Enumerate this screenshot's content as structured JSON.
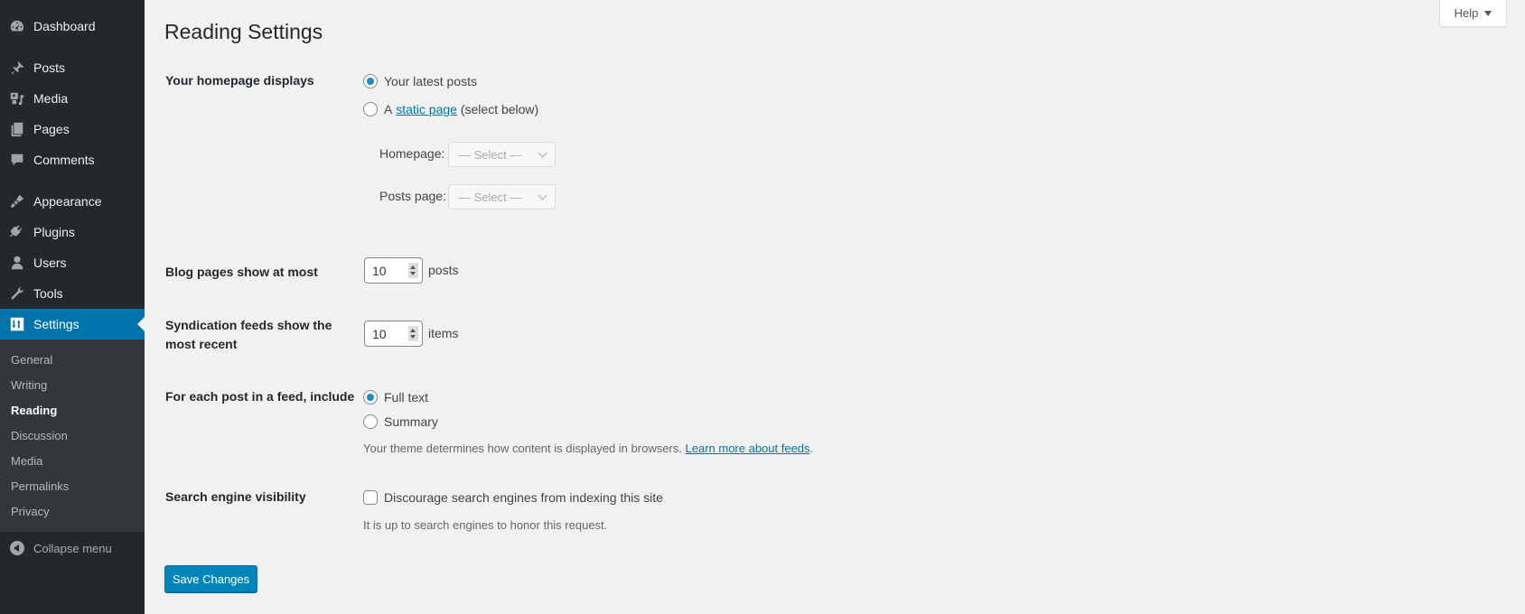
{
  "sidebar": {
    "items": [
      {
        "label": "Dashboard",
        "icon": "dashboard-icon"
      },
      {
        "label": "Posts",
        "icon": "pin-icon"
      },
      {
        "label": "Media",
        "icon": "media-icon"
      },
      {
        "label": "Pages",
        "icon": "pages-icon"
      },
      {
        "label": "Comments",
        "icon": "comment-icon"
      },
      {
        "label": "Appearance",
        "icon": "paintbrush-icon"
      },
      {
        "label": "Plugins",
        "icon": "plugin-icon"
      },
      {
        "label": "Users",
        "icon": "user-icon"
      },
      {
        "label": "Tools",
        "icon": "wrench-icon"
      },
      {
        "label": "Settings",
        "icon": "settings-icon",
        "current": true
      }
    ],
    "submenu": [
      {
        "label": "General"
      },
      {
        "label": "Writing"
      },
      {
        "label": "Reading",
        "current": true
      },
      {
        "label": "Discussion"
      },
      {
        "label": "Media"
      },
      {
        "label": "Permalinks"
      },
      {
        "label": "Privacy"
      }
    ],
    "collapse_label": "Collapse menu"
  },
  "header": {
    "help_label": "Help"
  },
  "page": {
    "title": "Reading Settings",
    "homepage": {
      "label": "Your homepage displays",
      "option_latest": "Your latest posts",
      "option_static_prefix": "A",
      "option_static_link": "static page",
      "option_static_suffix": "(select below)",
      "selected": "latest",
      "homepage_select_label": "Homepage:",
      "homepage_select_value": "— Select —",
      "posts_select_label": "Posts page:",
      "posts_select_value": "— Select —"
    },
    "blog_pages": {
      "label": "Blog pages show at most",
      "value": "10",
      "unit": "posts"
    },
    "syndication": {
      "label_line1": "Syndication feeds show the",
      "label_line2": "most recent",
      "value": "10",
      "unit": "items"
    },
    "feed_content": {
      "label": "For each post in a feed, include",
      "option_full": "Full text",
      "option_summary": "Summary",
      "selected": "full",
      "description": "Your theme determines how content is displayed in browsers.",
      "learn_more_link": "Learn more about feeds",
      "trailing": "."
    },
    "search_visibility": {
      "label": "Search engine visibility",
      "checkbox_label": "Discourage search engines from indexing this site",
      "checked": false,
      "description": "It is up to search engines to honor this request."
    },
    "save_label": "Save Changes"
  },
  "colors": {
    "sidebar_bg": "#23282d",
    "submenu_bg": "#32373c",
    "accent": "#0073aa",
    "button": "#0085ba",
    "page_bg": "#f1f1f1"
  }
}
